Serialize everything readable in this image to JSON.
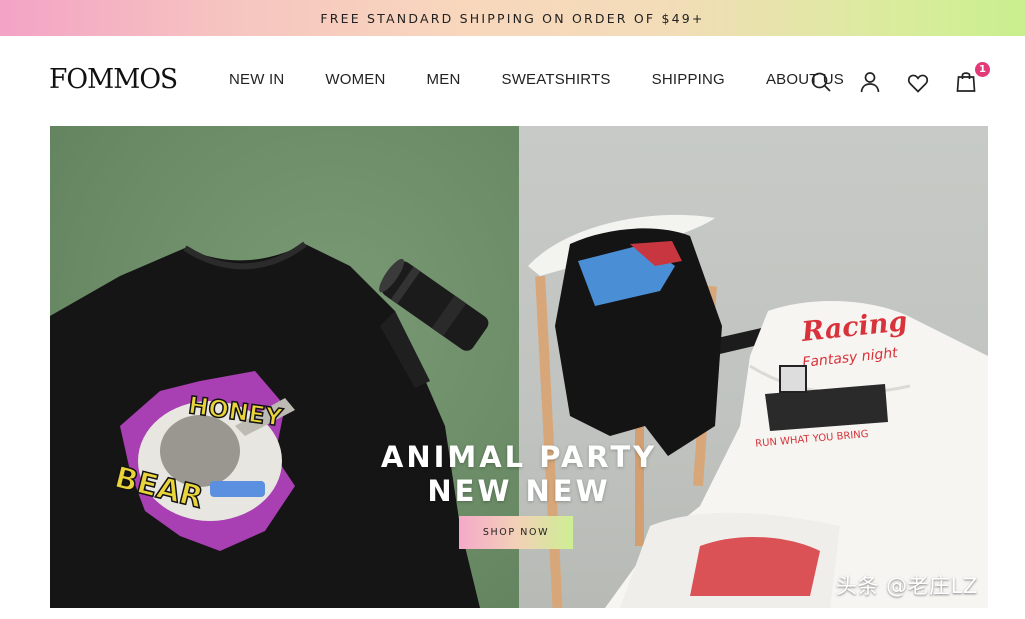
{
  "announcement": {
    "text": "FREE STANDARD SHIPPING ON ORDER OF $49+"
  },
  "header": {
    "logo": "FOMMOS",
    "nav": [
      "NEW IN",
      "WOMEN",
      "MEN",
      "SWEATSHIRTS",
      "SHIPPING",
      "ABOUT US"
    ],
    "icons": [
      "search-icon",
      "user-icon",
      "heart-icon",
      "bag-icon"
    ],
    "cart_count": "1"
  },
  "hero": {
    "title_line1": "ANIMAL PARTY",
    "title_line2": "NEW NEW",
    "button_label": "SHOP NOW",
    "left_shirt_print": [
      "HONEY",
      "BEAR"
    ],
    "right_shirt_print": [
      "Racing",
      "Fantasy night",
      "RUN WHAT YOU BRING"
    ]
  },
  "watermark": "头条 @老庄LZ",
  "colors": {
    "badge": "#e23a76",
    "hero_left_bg": "#6a8b66",
    "hero_right_bg": "#c0c3bf",
    "gradient_pink": "#f3a3c6",
    "gradient_green": "#c9ef8e"
  }
}
